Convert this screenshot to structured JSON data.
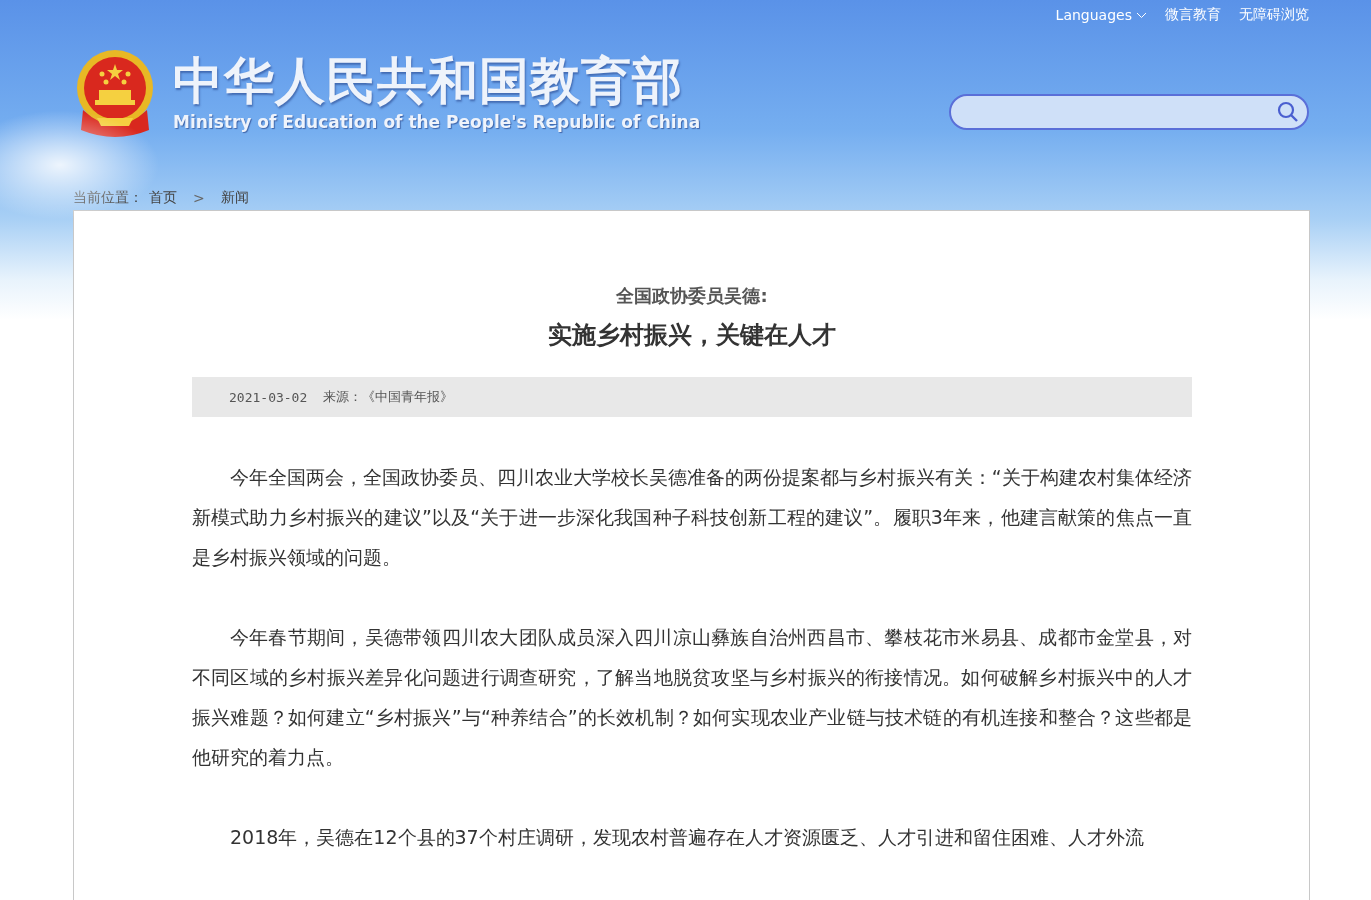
{
  "header": {
    "top_links": [
      {
        "kind": "dropdown",
        "label": "Languages"
      },
      {
        "kind": "link",
        "label": "微言教育"
      },
      {
        "kind": "link",
        "label": "无障碍浏览"
      }
    ],
    "logo_title": "中华人民共和国教育部",
    "logo_subtitle": "Ministry of Education of the People's Republic of China"
  },
  "breadcrumb": {
    "label": "当前位置：",
    "items": [
      "首页",
      "新闻"
    ],
    "separator": ">"
  },
  "article": {
    "subtitle": "全国政协委员吴德:",
    "title": "实施乡村振兴，关键在人才",
    "date": "2021-03-02",
    "source": "来源：《中国青年报》",
    "paragraphs": [
      "今年全国两会，全国政协委员、四川农业大学校长吴德准备的两份提案都与乡村振兴有关：“关于构建农村集体经济新模式助力乡村振兴的建议”以及“关于进一步深化我国种子科技创新工程的建议”。履职3年来，他建言献策的焦点一直是乡村振兴领域的问题。",
      "今年春节期间，吴德带领四川农大团队成员深入四川凉山彝族自治州西昌市、攀枝花市米易县、成都市金堂县，对不同区域的乡村振兴差异化问题进行调查研究，了解当地脱贫攻坚与乡村振兴的衔接情况。如何破解乡村振兴中的人才振兴难题？如何建立“乡村振兴”与“种养结合”的长效机制？如何实现农业产业链与技术链的有机连接和整合？这些都是他研究的着力点。",
      "2018年，吴德在12个县的37个村庄调研，发现农村普遍存在人才资源匮乏、人才引进和留住困难、人才外流"
    ]
  }
}
